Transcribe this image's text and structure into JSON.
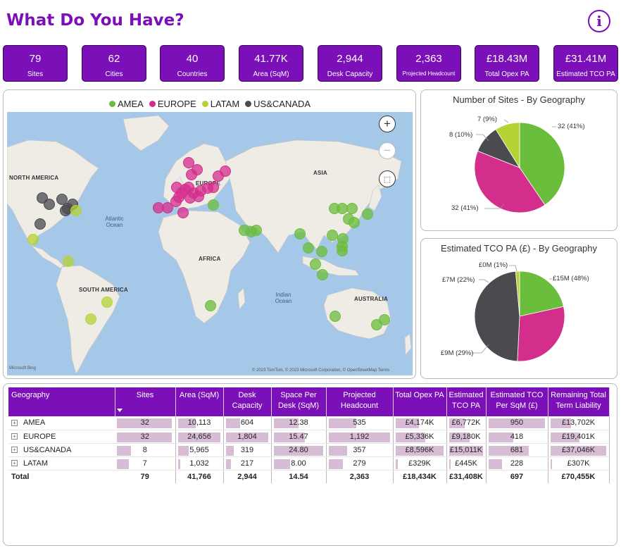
{
  "header": {
    "title": "What Do You Have?",
    "info_icon": "info-icon"
  },
  "kpis": [
    {
      "value": "79",
      "label": "Sites"
    },
    {
      "value": "62",
      "label": "Cities"
    },
    {
      "value": "40",
      "label": "Countries"
    },
    {
      "value": "41.77K",
      "label": "Area (SqM)"
    },
    {
      "value": "2,944",
      "label": "Desk Capacity"
    },
    {
      "value": "2,363",
      "label": "Projected Headcount"
    },
    {
      "value": "£18.43M",
      "label": "Total Opex PA"
    },
    {
      "value": "£31.41M",
      "label": "Estimated TCO PA"
    }
  ],
  "colors": {
    "accent": "#7B0FB8",
    "amea": "#6BBE3B",
    "europe": "#D42E8C",
    "latam": "#B5D334",
    "uscanada": "#4A4A4F",
    "bar": "#d7bcd6"
  },
  "map": {
    "legend": [
      {
        "name": "AMEA",
        "color": "#6BBE3B"
      },
      {
        "name": "EUROPE",
        "color": "#D42E8C"
      },
      {
        "name": "LATAM",
        "color": "#B5D334"
      },
      {
        "name": "US&CANADA",
        "color": "#4A4A4F"
      }
    ],
    "regions": {
      "north_america": "NORTH AMERICA",
      "south_america": "SOUTH AMERICA",
      "europe": "EUROPE",
      "asia": "ASIA",
      "africa": "AFRICA",
      "australia": "AUSTRALIA"
    },
    "oceans": {
      "atlantic": "Atlantic Ocean",
      "indian": "Indian Ocean"
    },
    "attribution": "© 2023 TomTom, © 2023 Microsoft Corporation, © OpenStreetMap  Terms",
    "brand": "Microsoft Bing",
    "controls": {
      "zoom_in": "+",
      "zoom_out": "−"
    }
  },
  "pie_sites": {
    "title": "Number of Sites - By Geography",
    "labels": {
      "amea": "32 (41%)",
      "europe": "32 (41%)",
      "uscanada": "8 (10%)",
      "latam": "7 (9%)"
    }
  },
  "pie_tco": {
    "title": "Estimated TCO PA (£) - By Geography",
    "labels": {
      "uscanada": "£15M (48%)",
      "europe": "£9M (29%)",
      "amea": "£7M (22%)",
      "latam": "£0M (1%)"
    }
  },
  "chart_data": [
    {
      "type": "pie",
      "title": "Number of Sites - By Geography",
      "categories": [
        "AMEA",
        "EUROPE",
        "US&CANADA",
        "LATAM"
      ],
      "values": [
        32,
        32,
        8,
        7
      ]
    },
    {
      "type": "pie",
      "title": "Estimated TCO PA (£) - By Geography",
      "categories": [
        "AMEA",
        "EUROPE",
        "US&CANADA",
        "LATAM"
      ],
      "values": [
        6772,
        9180,
        15011,
        445
      ]
    }
  ],
  "table": {
    "headers": [
      "Geography",
      "Sites",
      "Area (SqM)",
      "Desk Capacity",
      "Space Per Desk (SqM)",
      "Projected Headcount",
      "Total Opex PA",
      "Estimated TCO PA",
      "Estimated TCO Per SqM (£)",
      "Remaining Total Term Liability"
    ],
    "rows": [
      {
        "geo": "AMEA",
        "sites": "32",
        "area": "10,113",
        "desk": "604",
        "spd": "12.38",
        "head": "535",
        "opex": "£4,174K",
        "tco": "£6,772K",
        "tcosqm": "950",
        "liab": "£13,702K"
      },
      {
        "geo": "EUROPE",
        "sites": "32",
        "area": "24,656",
        "desk": "1,804",
        "spd": "15.47",
        "head": "1,192",
        "opex": "£5,336K",
        "tco": "£9,180K",
        "tcosqm": "418",
        "liab": "£19,401K"
      },
      {
        "geo": "US&CANADA",
        "sites": "8",
        "area": "5,965",
        "desk": "319",
        "spd": "24.80",
        "head": "357",
        "opex": "£8,596K",
        "tco": "£15,011K",
        "tcosqm": "681",
        "liab": "£37,046K"
      },
      {
        "geo": "LATAM",
        "sites": "7",
        "area": "1,032",
        "desk": "217",
        "spd": "8.00",
        "head": "279",
        "opex": "£329K",
        "tco": "£445K",
        "tcosqm": "228",
        "liab": "£307K"
      }
    ],
    "total": {
      "geo": "Total",
      "sites": "79",
      "area": "41,766",
      "desk": "2,944",
      "spd": "14.54",
      "head": "2,363",
      "opex": "£18,434K",
      "tco": "£31,408K",
      "tcosqm": "697",
      "liab": "£70,455K"
    }
  }
}
